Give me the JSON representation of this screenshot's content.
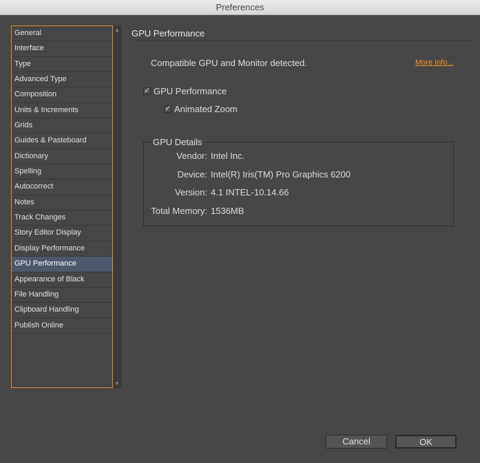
{
  "window": {
    "title": "Preferences"
  },
  "sidebar": {
    "items": [
      "General",
      "Interface",
      "Type",
      "Advanced Type",
      "Composition",
      "Units & Increments",
      "Grids",
      "Guides & Pasteboard",
      "Dictionary",
      "Spelling",
      "Autocorrect",
      "Notes",
      "Track Changes",
      "Story Editor Display",
      "Display Performance",
      "GPU Performance",
      "Appearance of Black",
      "File Handling",
      "Clipboard Handling",
      "Publish Online"
    ],
    "selected": "GPU Performance"
  },
  "main": {
    "title": "GPU Performance",
    "status": "Compatible GPU and Monitor detected.",
    "more_info": "More Info...",
    "gpu_performance": {
      "label": "GPU Performance",
      "checked": true
    },
    "animated_zoom": {
      "label": "Animated Zoom",
      "checked": true
    },
    "details": {
      "legend": "GPU Details",
      "rows": [
        {
          "k": "Vendor:",
          "v": "Intel Inc."
        },
        {
          "k": "Device:",
          "v": "Intel(R) Iris(TM) Pro Graphics 6200"
        },
        {
          "k": "Version:",
          "v": "4.1 INTEL-10.14.66"
        },
        {
          "k": "Total Memory:",
          "v": "1536MB"
        }
      ]
    }
  },
  "buttons": {
    "cancel": "Cancel",
    "ok": "OK"
  }
}
